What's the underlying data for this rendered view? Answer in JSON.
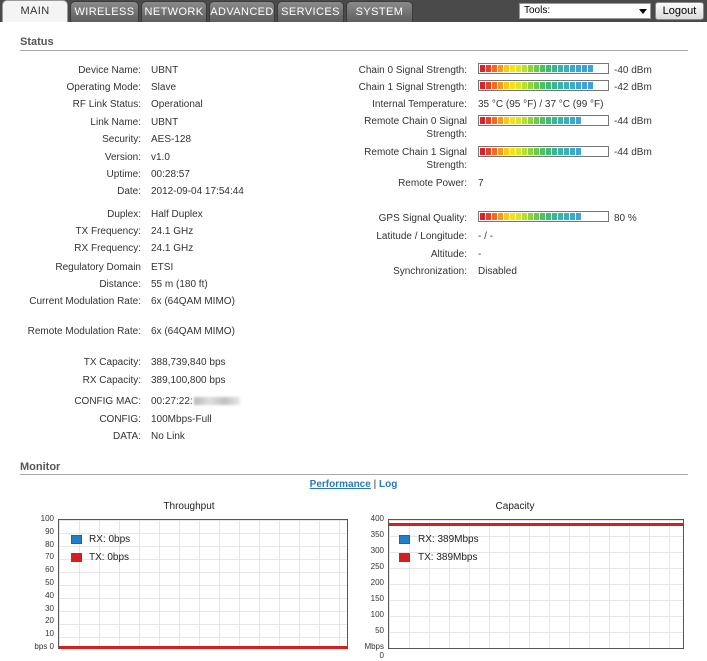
{
  "tabs": [
    {
      "label": "MAIN",
      "active": true
    },
    {
      "label": "WIRELESS",
      "active": false
    },
    {
      "label": "NETWORK",
      "active": false
    },
    {
      "label": "ADVANCED",
      "active": false
    },
    {
      "label": "SERVICES",
      "active": false
    },
    {
      "label": "SYSTEM",
      "active": false
    }
  ],
  "tools": {
    "selected": "Tools:"
  },
  "logout_label": "Logout",
  "status": {
    "title": "Status",
    "left": [
      {
        "label": "Device Name:",
        "value": "UBNT"
      },
      {
        "label": "Operating Mode:",
        "value": "Slave"
      },
      {
        "label": "RF Link Status:",
        "value": "Operational"
      },
      {
        "label": "Link Name:",
        "value": "UBNT"
      },
      {
        "label": "Security:",
        "value": "AES-128"
      },
      {
        "label": "Version:",
        "value": "v1.0"
      },
      {
        "label": "Uptime:",
        "value": "00:28:57"
      },
      {
        "label": "Date:",
        "value": "2012-09-04 17:54:44"
      },
      {
        "label": "Duplex:",
        "value": "Half Duplex"
      },
      {
        "label": "TX Frequency:",
        "value": "24.1 GHz"
      },
      {
        "label": "RX Frequency:",
        "value": "24.1 GHz"
      },
      {
        "label": "Regulatory Domain",
        "value": "ETSI"
      },
      {
        "label": "Distance:",
        "value": "55 m (180 ft)"
      },
      {
        "label": "Current Modulation Rate:",
        "value": "6x (64QAM MIMO)"
      },
      {
        "label": "Remote Modulation Rate:",
        "value": "6x (64QAM MIMO)"
      },
      {
        "label": "TX Capacity:",
        "value": "388,739,840 bps"
      },
      {
        "label": "RX Capacity:",
        "value": "389,100,800 bps"
      },
      {
        "label": "CONFIG MAC:",
        "value": "00:27:22:"
      },
      {
        "label": "CONFIG:",
        "value": "100Mbps-Full"
      },
      {
        "label": "DATA:",
        "value": "No Link"
      }
    ],
    "right": [
      {
        "label": "Chain 0 Signal Strength:",
        "value": "-40 dBm",
        "level": 0.93
      },
      {
        "label": "Chain 1 Signal Strength:",
        "value": "-42 dBm",
        "level": 0.9
      },
      {
        "label": "Internal Temperature:",
        "value": "35 °C (95 °F) / 37 °C (99 °F)"
      },
      {
        "label": "Remote Chain 0 Signal Strength:",
        "value": "-44 dBm",
        "level": 0.84
      },
      {
        "label": "Remote Chain 1 Signal Strength:",
        "value": "-44 dBm",
        "level": 0.84
      },
      {
        "label": "Remote Power:",
        "value": "7"
      },
      {
        "label": "GPS Signal Quality:",
        "value": "80 %",
        "level": 0.8
      },
      {
        "label": "Latitude / Longitude:",
        "value": "- / -"
      },
      {
        "label": "Altitude:",
        "value": "-"
      },
      {
        "label": "Synchronization:",
        "value": "Disabled"
      }
    ]
  },
  "monitor": {
    "title": "Monitor",
    "link_performance": "Performance",
    "link_separator": "|",
    "link_log": "Log",
    "throughput": {
      "title": "Throughput",
      "yticks": [
        "100",
        "90",
        "80",
        "70",
        "60",
        "50",
        "40",
        "30",
        "20",
        "10",
        "bps 0"
      ],
      "legend": [
        {
          "label": "RX: 0bps",
          "color": "#1f7fc8"
        },
        {
          "label": "TX: 0bps",
          "color": "#d21f1f"
        }
      ],
      "tx_value_fraction": 0.0
    },
    "capacity": {
      "title": "Capacity",
      "yticks": [
        "400",
        "350",
        "300",
        "250",
        "200",
        "150",
        "100",
        "50",
        "Mbps 0"
      ],
      "legend": [
        {
          "label": "RX: 389Mbps",
          "color": "#1f7fc8"
        },
        {
          "label": "TX: 389Mbps",
          "color": "#d21f1f"
        }
      ],
      "tx_value_fraction": 0.9725
    }
  }
}
